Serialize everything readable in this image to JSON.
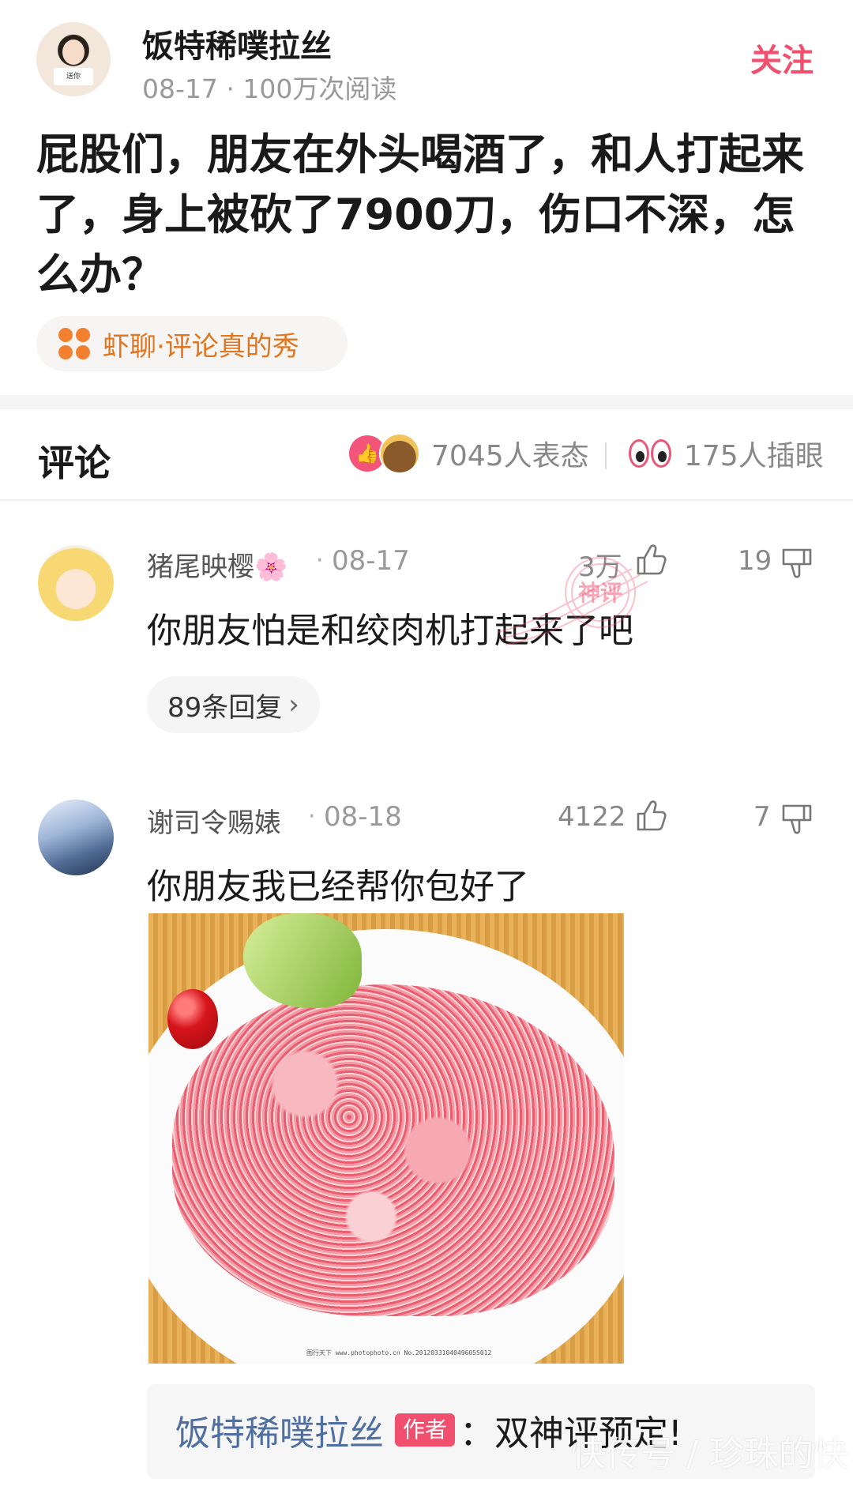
{
  "header": {
    "author_name": "饭特稀噗拉丝",
    "meta": "08-17 · 100万次阅读",
    "follow_label": "关注",
    "avatar_sign_text": "送你"
  },
  "post": {
    "title": "屁股们，朋友在外头喝酒了，和人打起来了，身上被砍了7900刀，伤口不深，怎么办？",
    "tag_label": "虾聊·评论真的秀"
  },
  "comments_header": {
    "title": "评论",
    "reactions_text": "7045人表态",
    "eyes_text": "175人插眼"
  },
  "comments": [
    {
      "name": "猪尾映樱🌸",
      "date": "08-17",
      "likes": "3万",
      "dislikes": "19",
      "text": "你朋友怕是和绞肉机打起来了吧",
      "reply_label": "89条回复"
    },
    {
      "name": "谢司令赐婊",
      "date": "08-18",
      "likes": "4122",
      "dislikes": "7",
      "text": "你朋友我已经帮你包好了",
      "image_watermark": "图行天下 www.photophoto.cn No.20120331040496055012",
      "author_reply": {
        "name": "饭特稀噗拉丝",
        "badge": "作者",
        "text": "：双神评预定!"
      }
    }
  ],
  "overlays": {
    "stamp_text": "神评",
    "site_watermark": "快传号 / 珍珠的快"
  },
  "colors": {
    "accent": "#f0506e",
    "tag_orange": "#e0761f",
    "author_blue": "#4f6fa1"
  }
}
